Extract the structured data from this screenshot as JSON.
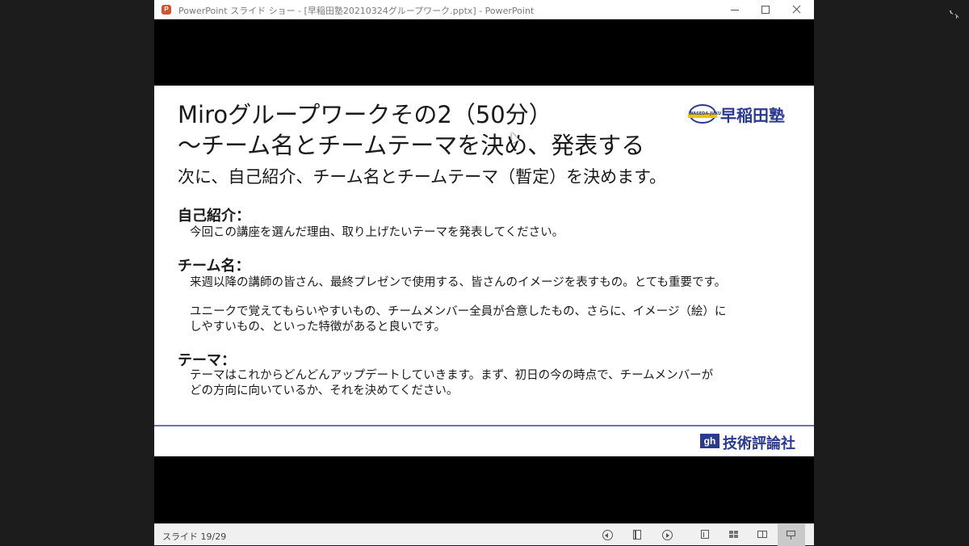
{
  "window": {
    "title": "PowerPoint スライド ショー - [早稲田塾20210324グループワーク.pptx] - PowerPoint",
    "icon_letter": "P"
  },
  "slide": {
    "title_line1": "Miroグループワークその2（50分）",
    "title_line2": "～チーム名とチームテーマを決め、発表する",
    "subtitle": "次に、自己紹介、チーム名とチームテーマ（暫定）を決めます。",
    "logo_text": "早稲田塾",
    "logo_globe_text": "WASEDA-JUKU",
    "sections": [
      {
        "heading": "自己紹介：",
        "lines": [
          "今回この講座を選んだ理由、取り上げたいテーマを発表してください。"
        ]
      },
      {
        "heading": "チーム名：",
        "lines": [
          "来週以降の講師の皆さん、最終プレゼンで使用する、皆さんのイメージを表すもの。とても重要です。",
          "ユニークで覚えてもらいやすいもの、チームメンバー全員が合意したもの、さらに、イメージ（絵）に",
          "しやすいもの、といった特徴があると良いです。"
        ]
      },
      {
        "heading": "テーマ：",
        "lines": [
          "テーマはこれからどんどんアップデートしていきます。まず、初日の今の時点で、チームメンバーが",
          "どの方向に向いているか、それを決めてください。"
        ]
      }
    ],
    "footer_mark": "gh",
    "footer_text": "技術評論社"
  },
  "statusbar": {
    "slide_counter": "スライド 19/29"
  },
  "colors": {
    "brand_blue": "#2a3b8f",
    "footer_line": "#6b6fc4",
    "ppt_orange": "#d35230"
  },
  "icons": [
    "powerpoint-icon",
    "minimize-icon",
    "maximize-icon",
    "close-icon",
    "previous-icon",
    "slide-menu-icon",
    "next-icon",
    "normal-view-icon",
    "slide-sorter-icon",
    "reading-view-icon",
    "slideshow-icon",
    "exit-fullscreen-icon"
  ]
}
